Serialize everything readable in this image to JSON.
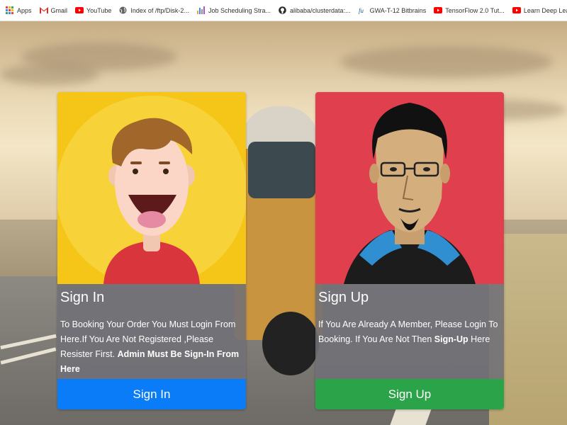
{
  "bookmarks": [
    {
      "label": "Apps",
      "icon": "apps-grid-icon",
      "color": "#e8453c"
    },
    {
      "label": "Gmail",
      "icon": "gmail-icon",
      "color": "#d93025"
    },
    {
      "label": "YouTube",
      "icon": "youtube-icon",
      "color": "#ff0000"
    },
    {
      "label": "Index of /ftp/Disk-2...",
      "icon": "globe-icon",
      "color": "#5f6368"
    },
    {
      "label": "Job Scheduling Stra...",
      "icon": "chart-icon",
      "color": "#8e8e8e"
    },
    {
      "label": "alibaba/clusterdata:...",
      "icon": "github-icon",
      "color": "#24292e"
    },
    {
      "label": "GWA-T-12 Bitbrains",
      "icon": "tu-icon",
      "color": "#1b5eab"
    },
    {
      "label": "TensorFlow 2.0 Tut...",
      "icon": "youtube-icon",
      "color": "#ff0000"
    },
    {
      "label": "Learn Deep Learnin...",
      "icon": "youtube-icon",
      "color": "#ff0000"
    }
  ],
  "signin_card": {
    "title": "Sign In",
    "text_plain": "To Booking Your Order You Must Login From Here.If You Are Not Registered ,Please Resister First. ",
    "text_bold": "Admin Must Be Sign-In From Here",
    "button": "Sign In",
    "bg_color": "#f5c518",
    "button_color": "#0a7cf7"
  },
  "signup_card": {
    "title": "Sign Up",
    "text_plain_1": "If You Are Already A Member, Please Login To Booking. If You Are Not Then ",
    "text_bold": "Sign-Up",
    "text_plain_2": " Here",
    "button": "Sign Up",
    "bg_color": "#e0404e",
    "button_color": "#2ba449"
  }
}
